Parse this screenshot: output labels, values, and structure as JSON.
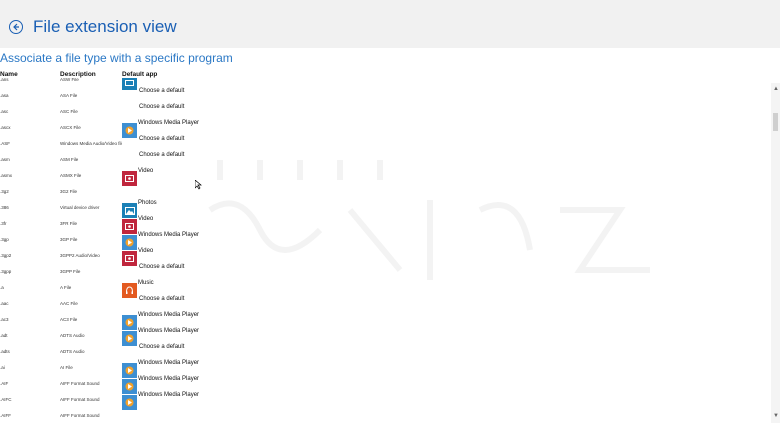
{
  "header": {
    "back_icon": "arrow-left-circle-icon",
    "title": "File extension view",
    "accent": "#1a5fb4"
  },
  "subtitle": "Associate a file type with a specific program",
  "columns": {
    "name": "Name",
    "description": "Description",
    "default_app": "Default app"
  },
  "rows": [
    {
      "ext": ".ans",
      "desc": "ASW File",
      "app": "",
      "icon": "partial"
    },
    {
      "ext": ".asa",
      "desc": "ASA File",
      "app": "Choose a default",
      "icon": "none"
    },
    {
      "ext": ".asc",
      "desc": "ASC File",
      "app": "Choose a default",
      "icon": "none"
    },
    {
      "ext": ".ascx",
      "desc": "ASCX File",
      "app": "Windows Media Player",
      "icon": "wmp"
    },
    {
      "ext": ".ASF",
      "desc": "Windows Media Audio/Video file",
      "app": "Choose a default",
      "icon": "none"
    },
    {
      "ext": ".asm",
      "desc": "ASM File",
      "app": "Choose a default",
      "icon": "none"
    },
    {
      "ext": ".asmx",
      "desc": "ASMX File",
      "app": "Video",
      "icon": "video"
    },
    {
      "ext": ".3g2",
      "desc": "3G2 File",
      "app": "",
      "icon": "none"
    },
    {
      "ext": ".386",
      "desc": "Virtual device driver",
      "app": "Photos",
      "icon": "photos"
    },
    {
      "ext": ".3fr",
      "desc": "3FR File",
      "app": "Video",
      "icon": "video"
    },
    {
      "ext": ".3gp",
      "desc": "3GP File",
      "app": "Windows Media Player",
      "icon": "wmp"
    },
    {
      "ext": ".3gp2",
      "desc": "3GPP2 Audio/Video",
      "app": "Video",
      "icon": "video"
    },
    {
      "ext": ".3gpp",
      "desc": "3GPP File",
      "app": "Choose a default",
      "icon": "none"
    },
    {
      "ext": ".a",
      "desc": "A File",
      "app": "Music",
      "icon": "music"
    },
    {
      "ext": ".aac",
      "desc": "AAC File",
      "app": "Choose a default",
      "icon": "none"
    },
    {
      "ext": ".ac3",
      "desc": "AC3 File",
      "app": "Windows Media Player",
      "icon": "wmp"
    },
    {
      "ext": ".adt",
      "desc": "ADTS Audio",
      "app": "Windows Media Player",
      "icon": "wmp"
    },
    {
      "ext": ".adts",
      "desc": "ADTS Audio",
      "app": "Choose a default",
      "icon": "none"
    },
    {
      "ext": ".ai",
      "desc": "AI File",
      "app": "Windows Media Player",
      "icon": "wmp"
    },
    {
      "ext": ".AIF",
      "desc": "AIFF Format Sound",
      "app": "Windows Media Player",
      "icon": "wmp"
    },
    {
      "ext": ".AIFC",
      "desc": "AIFF Format Sound",
      "app": "Windows Media Player",
      "icon": "wmp"
    },
    {
      "ext": ".AIFF",
      "desc": "AIFF Format Sound",
      "app": "",
      "icon": "none"
    }
  ],
  "icon_colors": {
    "wmp": "#3d8fd2",
    "video": "#c0263d",
    "photos": "#1b80b6",
    "music": "#e35a20"
  }
}
